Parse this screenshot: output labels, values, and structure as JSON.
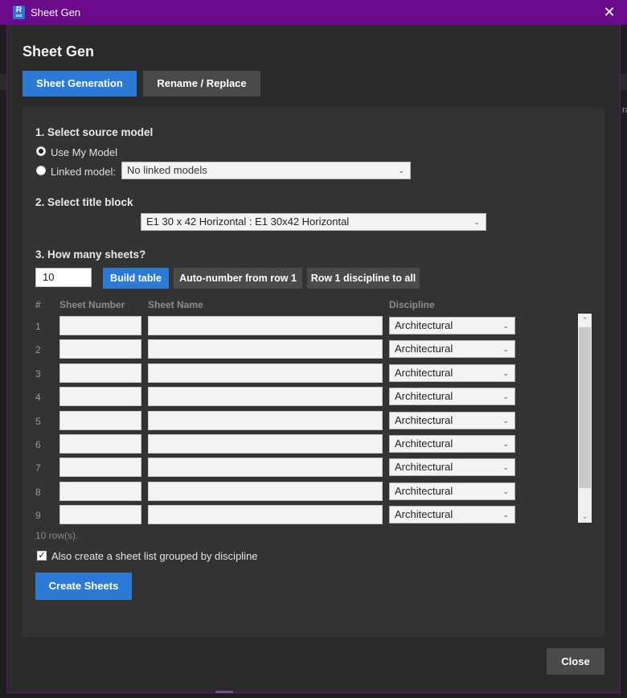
{
  "window": {
    "title": "Sheet Gen",
    "close_glyph": "✕",
    "icon_letter": "R",
    "icon_sub": "xxx"
  },
  "page": {
    "heading": "Sheet Gen"
  },
  "tabs": [
    {
      "label": "Sheet Generation",
      "active": true
    },
    {
      "label": "Rename / Replace",
      "active": false
    }
  ],
  "source": {
    "heading": "1.  Select source model",
    "use_my_model": "Use My Model",
    "linked_model": "Linked model:",
    "linked_value": "No linked models",
    "selected": "use_my_model"
  },
  "titleblock": {
    "heading": "2.  Select title block",
    "value": "E1 30 x 42 Horizontal : E1 30x42 Horizontal"
  },
  "sheets": {
    "heading": "3.  How many sheets?",
    "count": "10",
    "build_label": "Build table",
    "autonumber_label": "Auto-number from row 1",
    "discipline_all_label": "Row 1 discipline to all"
  },
  "table": {
    "headers": {
      "num": "#",
      "sheet_number": "Sheet Number",
      "sheet_name": "Sheet Name",
      "discipline": "Discipline"
    },
    "rows": [
      {
        "n": "1",
        "discipline": "Architectural"
      },
      {
        "n": "2",
        "discipline": "Architectural"
      },
      {
        "n": "3",
        "discipline": "Architectural"
      },
      {
        "n": "4",
        "discipline": "Architectural"
      },
      {
        "n": "5",
        "discipline": "Architectural"
      },
      {
        "n": "6",
        "discipline": "Architectural"
      },
      {
        "n": "7",
        "discipline": "Architectural"
      },
      {
        "n": "8",
        "discipline": "Architectural"
      },
      {
        "n": "9",
        "discipline": "Architectural"
      }
    ],
    "row_count": "10 row(s)."
  },
  "options": {
    "sheet_list_label": "Also create a sheet list grouped by discipline",
    "sheet_list_checked": true
  },
  "actions": {
    "create_label": "Create Sheets",
    "close_label": "Close"
  },
  "colors": {
    "accent": "#2a7ad6",
    "titlebar": "#6c0a8c",
    "panel": "#333333",
    "background": "#2b2b2b"
  },
  "icons": {
    "dropdown": "chevron-down-icon",
    "close": "close-icon",
    "check": "checkmark-icon"
  }
}
